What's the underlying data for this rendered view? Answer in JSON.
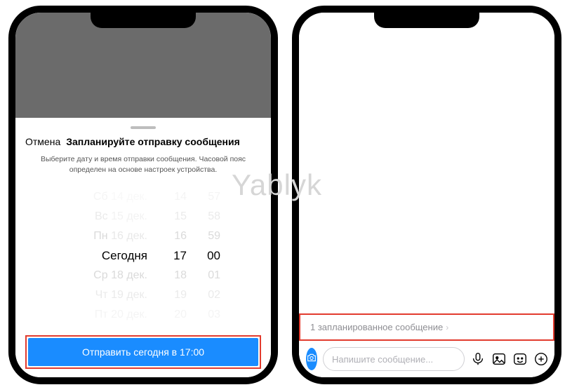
{
  "watermark": "Yablyk",
  "phone1": {
    "cancel": "Отмена",
    "title": "Запланируйте отправку сообщения",
    "subtitle": "Выберите дату и время отправки сообщения. Часовой пояс определен на основе настроек устройства.",
    "picker": {
      "dates": [
        "Сб 14 дек.",
        "Вс 15 дек.",
        "Пн 16 дек.",
        "Сегодня",
        "Ср 18 дек.",
        "Чт 19 дек.",
        "Пт 20 дек."
      ],
      "hours": [
        "14",
        "15",
        "16",
        "17",
        "18",
        "19",
        "20"
      ],
      "minutes": [
        "57",
        "58",
        "59",
        "00",
        "01",
        "02",
        "03"
      ],
      "selected_index": 3
    },
    "send_button": "Отправить сегодня в 17:00"
  },
  "phone2": {
    "scheduled_bar": "1 запланированное сообщение",
    "input_placeholder": "Напишите сообщение..."
  }
}
